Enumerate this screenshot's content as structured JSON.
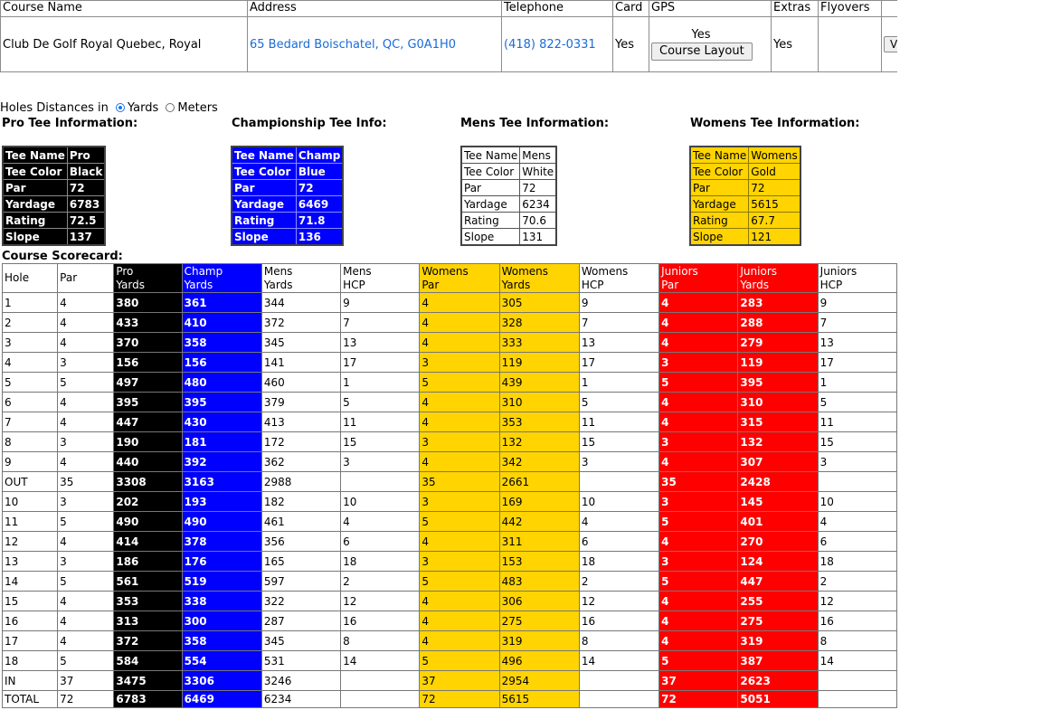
{
  "course_table": {
    "headers": [
      "Course Name",
      "Address",
      "Telephone",
      "Card",
      "GPS",
      "Extras",
      "Flyovers"
    ],
    "course_name": "Club De Golf Royal Quebec, Royal",
    "address": "65 Bedard Boischatel, QC, G0A1H0",
    "telephone": "(418) 822-0331",
    "card": "Yes",
    "gps_text": "Yes",
    "gps_button": "Course Layout",
    "extras": "Yes",
    "cut_button": "V"
  },
  "units": {
    "label": "Holes Distances in",
    "yards": "Yards",
    "meters": "Meters",
    "selected": "Yards"
  },
  "tee_headings": {
    "pro": "Pro Tee Information:",
    "champ": "Championship Tee Info:",
    "mens": "Mens Tee Information:",
    "womens": "Womens Tee Information:"
  },
  "tee_labels": [
    "Tee Name",
    "Tee Color",
    "Par",
    "Yardage",
    "Rating",
    "Slope"
  ],
  "tees": {
    "pro": [
      "Pro",
      "Black",
      "72",
      "6783",
      "72.5",
      "137"
    ],
    "champ": [
      "Champ",
      "Blue",
      "72",
      "6469",
      "71.8",
      "136"
    ],
    "mens": [
      "Mens",
      "White",
      "72",
      "6234",
      "70.6",
      "131"
    ],
    "womens": [
      "Womens",
      "Gold",
      "72",
      "5615",
      "67.7",
      "121"
    ]
  },
  "scorecard": {
    "title": "Course Scorecard:",
    "headers": [
      [
        "Hole"
      ],
      [
        "Par"
      ],
      [
        "Pro",
        "Yards"
      ],
      [
        "Champ",
        "Yards"
      ],
      [
        "Mens",
        "Yards"
      ],
      [
        "Mens",
        "HCP"
      ],
      [
        "Womens",
        "Par"
      ],
      [
        "Womens",
        "Yards"
      ],
      [
        "Womens",
        "HCP"
      ],
      [
        "Juniors",
        "Par"
      ],
      [
        "Juniors",
        "Yards"
      ],
      [
        "Juniors",
        "HCP"
      ]
    ],
    "rows": [
      [
        "1",
        "4",
        "380",
        "361",
        "344",
        "9",
        "4",
        "305",
        "9",
        "4",
        "283",
        "9"
      ],
      [
        "2",
        "4",
        "433",
        "410",
        "372",
        "7",
        "4",
        "328",
        "7",
        "4",
        "288",
        "7"
      ],
      [
        "3",
        "4",
        "370",
        "358",
        "345",
        "13",
        "4",
        "333",
        "13",
        "4",
        "279",
        "13"
      ],
      [
        "4",
        "3",
        "156",
        "156",
        "141",
        "17",
        "3",
        "119",
        "17",
        "3",
        "119",
        "17"
      ],
      [
        "5",
        "5",
        "497",
        "480",
        "460",
        "1",
        "5",
        "439",
        "1",
        "5",
        "395",
        "1"
      ],
      [
        "6",
        "4",
        "395",
        "395",
        "379",
        "5",
        "4",
        "310",
        "5",
        "4",
        "310",
        "5"
      ],
      [
        "7",
        "4",
        "447",
        "430",
        "413",
        "11",
        "4",
        "353",
        "11",
        "4",
        "315",
        "11"
      ],
      [
        "8",
        "3",
        "190",
        "181",
        "172",
        "15",
        "3",
        "132",
        "15",
        "3",
        "132",
        "15"
      ],
      [
        "9",
        "4",
        "440",
        "392",
        "362",
        "3",
        "4",
        "342",
        "3",
        "4",
        "307",
        "3"
      ],
      [
        "OUT",
        "35",
        "3308",
        "3163",
        "2988",
        "",
        "35",
        "2661",
        "",
        "35",
        "2428",
        ""
      ],
      [
        "10",
        "3",
        "202",
        "193",
        "182",
        "10",
        "3",
        "169",
        "10",
        "3",
        "145",
        "10"
      ],
      [
        "11",
        "5",
        "490",
        "490",
        "461",
        "4",
        "5",
        "442",
        "4",
        "5",
        "401",
        "4"
      ],
      [
        "12",
        "4",
        "414",
        "378",
        "356",
        "6",
        "4",
        "311",
        "6",
        "4",
        "270",
        "6"
      ],
      [
        "13",
        "3",
        "186",
        "176",
        "165",
        "18",
        "3",
        "153",
        "18",
        "3",
        "124",
        "18"
      ],
      [
        "14",
        "5",
        "561",
        "519",
        "597",
        "2",
        "5",
        "483",
        "2",
        "5",
        "447",
        "2"
      ],
      [
        "15",
        "4",
        "353",
        "338",
        "322",
        "12",
        "4",
        "306",
        "12",
        "4",
        "255",
        "12"
      ],
      [
        "16",
        "4",
        "313",
        "300",
        "287",
        "16",
        "4",
        "275",
        "16",
        "4",
        "275",
        "16"
      ],
      [
        "17",
        "4",
        "372",
        "358",
        "345",
        "8",
        "4",
        "319",
        "8",
        "4",
        "319",
        "8"
      ],
      [
        "18",
        "5",
        "584",
        "554",
        "531",
        "14",
        "5",
        "496",
        "14",
        "5",
        "387",
        "14"
      ],
      [
        "IN",
        "37",
        "3475",
        "3306",
        "3246",
        "",
        "37",
        "2954",
        "",
        "37",
        "2623",
        ""
      ],
      [
        "TOTAL",
        "72",
        "6783",
        "6469",
        "6234",
        "",
        "72",
        "5615",
        "",
        "72",
        "5051",
        ""
      ]
    ]
  }
}
